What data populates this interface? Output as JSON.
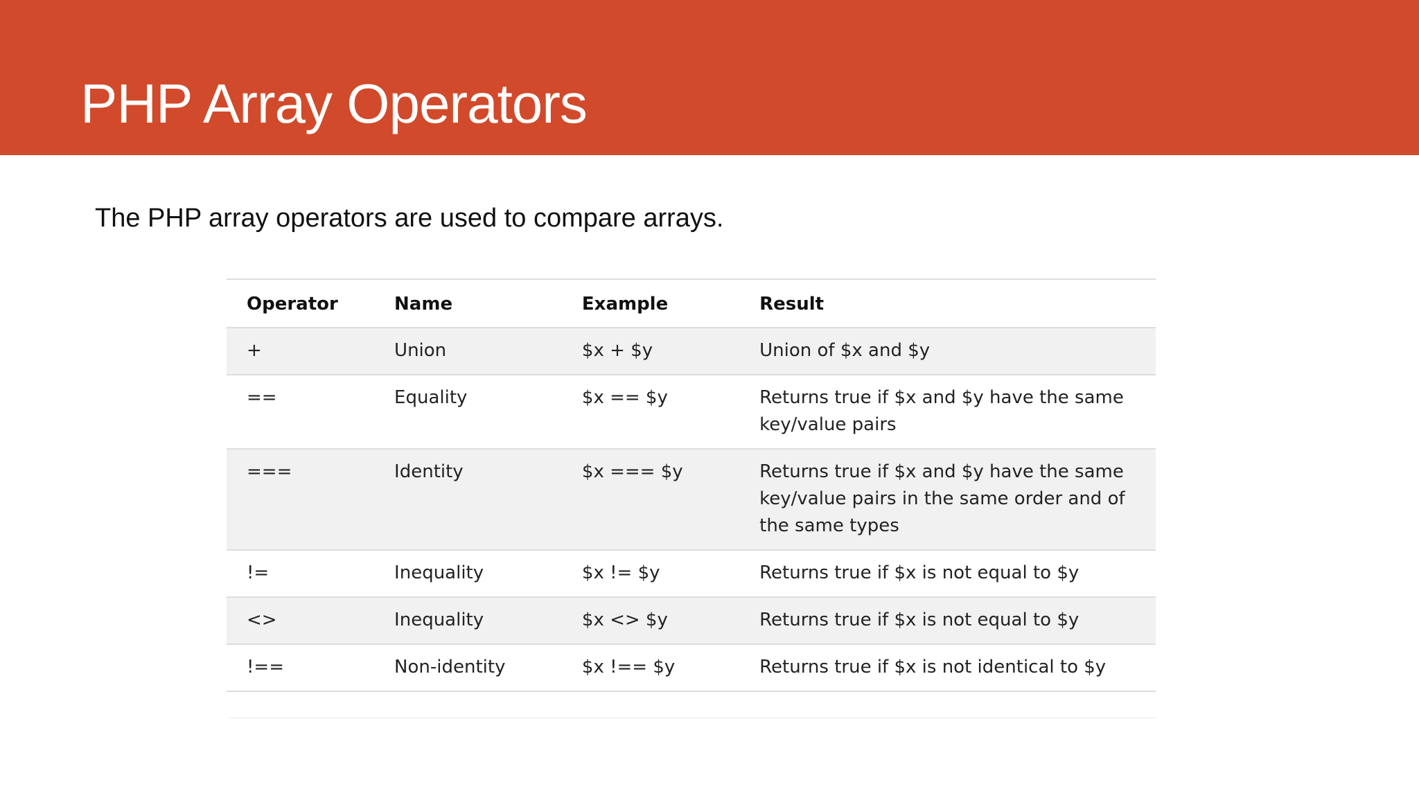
{
  "slide": {
    "title": "PHP Array Operators",
    "intro": "The PHP array operators are used to compare arrays.",
    "accent_color": "#d14a2b"
  },
  "table": {
    "headers": [
      "Operator",
      "Name",
      "Example",
      "Result"
    ],
    "rows": [
      [
        "+",
        "Union",
        "$x + $y",
        "Union of $x and $y"
      ],
      [
        "==",
        "Equality",
        "$x == $y",
        "Returns true if $x and $y have the same key/value pairs"
      ],
      [
        "===",
        "Identity",
        "$x === $y",
        "Returns true if $x and $y have the same key/value pairs in the same order and of the same types"
      ],
      [
        "!=",
        "Inequality",
        "$x != $y",
        "Returns true if $x is not equal to $y"
      ],
      [
        "<>",
        "Inequality",
        "$x <> $y",
        "Returns true if $x is not equal to $y"
      ],
      [
        "!==",
        "Non-identity",
        "$x !== $y",
        "Returns true if $x is not identical to $y"
      ]
    ]
  }
}
